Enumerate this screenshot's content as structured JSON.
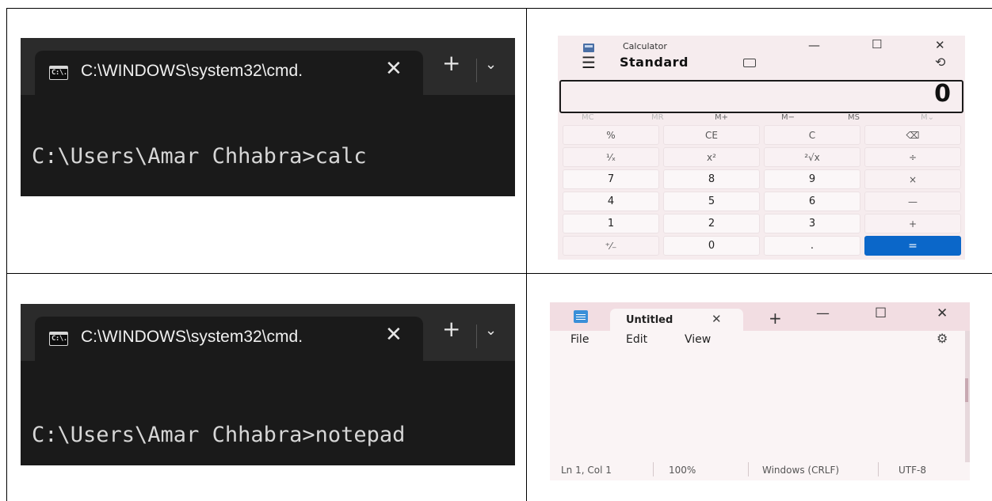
{
  "terminals": [
    {
      "tab_title": "C:\\WINDOWS\\system32\\cmd.",
      "icon_text": "C:\\.",
      "close_glyph": "✕",
      "new_tab_glyph": "+",
      "dropdown_glyph": "⌄",
      "prompt": "C:\\Users\\Amar Chhabra>calc"
    },
    {
      "tab_title": "C:\\WINDOWS\\system32\\cmd.",
      "icon_text": "C:\\.",
      "close_glyph": "✕",
      "new_tab_glyph": "+",
      "dropdown_glyph": "⌄",
      "prompt": "C:\\Users\\Amar Chhabra>notepad"
    }
  ],
  "calculator": {
    "app_title": "Calculator",
    "mode": "Standard",
    "display_value": "0",
    "window_buttons": {
      "minimize": "—",
      "maximize": "☐",
      "close": "✕"
    },
    "menu_glyph": "☰",
    "history_glyph": "⟲",
    "memory_buttons": [
      "MC",
      "MR",
      "M+",
      "M−",
      "MS",
      "M⌄"
    ],
    "keys": [
      [
        "%",
        "CE",
        "C",
        "⌫"
      ],
      [
        "¹⁄ₓ",
        "x²",
        "²√x",
        "÷"
      ],
      [
        "7",
        "8",
        "9",
        "×"
      ],
      [
        "4",
        "5",
        "6",
        "—"
      ],
      [
        "1",
        "2",
        "3",
        "+"
      ],
      [
        "⁺⁄₋",
        "0",
        ".",
        "="
      ]
    ],
    "accent_color": "#0b67c9"
  },
  "notepad": {
    "tab_title": "Untitled",
    "tab_close": "✕",
    "new_tab": "+",
    "window_buttons": {
      "minimize": "—",
      "maximize": "☐",
      "close": "✕"
    },
    "menu": {
      "file": "File",
      "edit": "Edit",
      "view": "View"
    },
    "settings_glyph": "⚙",
    "status": {
      "position": "Ln 1, Col 1",
      "zoom": "100%",
      "line_ending": "Windows (CRLF)",
      "encoding": "UTF-8"
    }
  }
}
